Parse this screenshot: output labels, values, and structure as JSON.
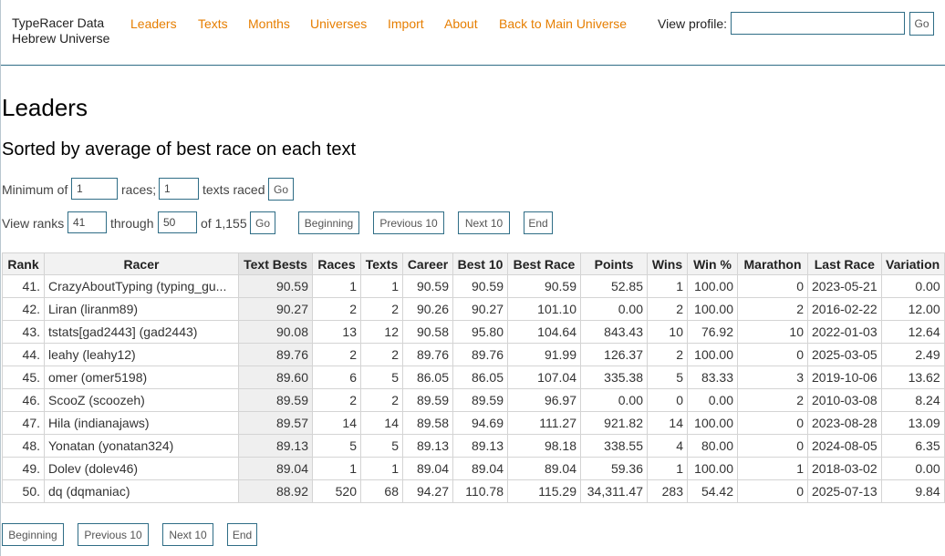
{
  "brand": {
    "line1": "TypeRacer Data",
    "line2": "Hebrew Universe"
  },
  "nav": {
    "leaders": "Leaders",
    "texts": "Texts",
    "months": "Months",
    "universes": "Universes",
    "import": "Import",
    "about": "About",
    "back": "Back to Main Universe"
  },
  "view_profile": {
    "label": "View profile:",
    "value": "",
    "go": "Go"
  },
  "page": {
    "title": "Leaders",
    "subtitle": "Sorted by average of best race on each text"
  },
  "filter": {
    "min_label": "Minimum of",
    "races_value": "1",
    "races_label": "races;",
    "texts_value": "1",
    "texts_label": "texts raced",
    "go": "Go"
  },
  "ranks": {
    "label": "View ranks",
    "from": "41",
    "through_label": "through",
    "to": "50",
    "of_label": "of 1,155",
    "go": "Go"
  },
  "pager": {
    "beginning": "Beginning",
    "previous": "Previous 10",
    "next": "Next 10",
    "end": "End"
  },
  "table": {
    "headers": [
      "Rank",
      "Racer",
      "Text Bests",
      "Races",
      "Texts",
      "Career",
      "Best 10",
      "Best Race",
      "Points",
      "Wins",
      "Win %",
      "Marathon",
      "Last Race",
      "Variation"
    ],
    "rows": [
      [
        "41.",
        "CrazyAboutTyping (typing_gu...",
        "90.59",
        "1",
        "1",
        "90.59",
        "90.59",
        "90.59",
        "52.85",
        "1",
        "100.00",
        "0",
        "2023-05-21",
        "0.00"
      ],
      [
        "42.",
        "Liran (liranm89)",
        "90.27",
        "2",
        "2",
        "90.26",
        "90.27",
        "101.10",
        "0.00",
        "2",
        "100.00",
        "2",
        "2016-02-22",
        "12.00"
      ],
      [
        "43.",
        "tstats[gad2443] (gad2443)",
        "90.08",
        "13",
        "12",
        "90.58",
        "95.80",
        "104.64",
        "843.43",
        "10",
        "76.92",
        "10",
        "2022-01-03",
        "12.64"
      ],
      [
        "44.",
        "leahy (leahy12)",
        "89.76",
        "2",
        "2",
        "89.76",
        "89.76",
        "91.99",
        "126.37",
        "2",
        "100.00",
        "0",
        "2025-03-05",
        "2.49"
      ],
      [
        "45.",
        "omer (omer5198)",
        "89.60",
        "6",
        "5",
        "86.05",
        "86.05",
        "107.04",
        "335.38",
        "5",
        "83.33",
        "3",
        "2019-10-06",
        "13.62"
      ],
      [
        "46.",
        "ScooZ (scoozeh)",
        "89.59",
        "2",
        "2",
        "89.59",
        "89.59",
        "96.97",
        "0.00",
        "0",
        "0.00",
        "2",
        "2010-03-08",
        "8.24"
      ],
      [
        "47.",
        "Hila (indianajaws)",
        "89.57",
        "14",
        "14",
        "89.58",
        "94.69",
        "111.27",
        "921.82",
        "14",
        "100.00",
        "0",
        "2023-08-28",
        "13.09"
      ],
      [
        "48.",
        "Yonatan (yonatan324)",
        "89.13",
        "5",
        "5",
        "89.13",
        "89.13",
        "98.18",
        "338.55",
        "4",
        "80.00",
        "0",
        "2024-08-05",
        "6.35"
      ],
      [
        "49.",
        "Dolev (dolev46)",
        "89.04",
        "1",
        "1",
        "89.04",
        "89.04",
        "89.04",
        "59.36",
        "1",
        "100.00",
        "1",
        "2018-03-02",
        "0.00"
      ],
      [
        "50.",
        "dq (dqmaniac)",
        "88.92",
        "520",
        "68",
        "94.27",
        "110.78",
        "115.29",
        "34,311.47",
        "283",
        "54.42",
        "0",
        "2025-07-13",
        "9.84"
      ]
    ]
  }
}
